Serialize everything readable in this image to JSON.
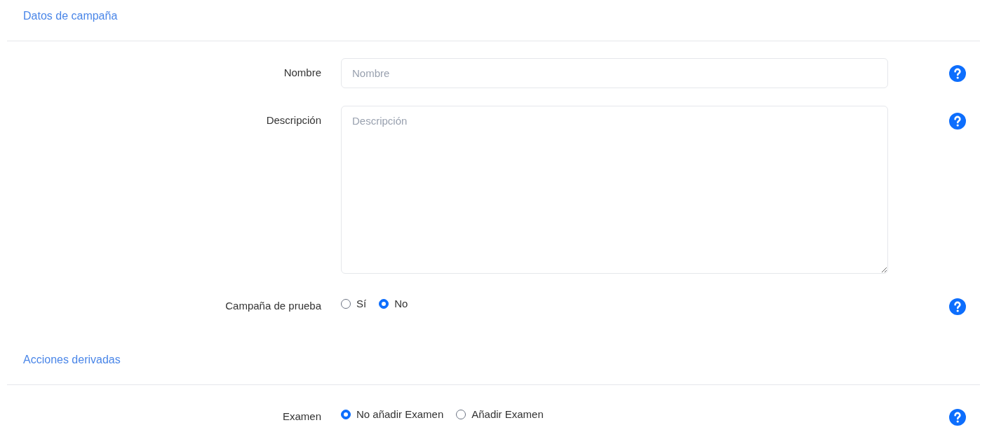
{
  "sections": [
    {
      "title": "Datos de campaña",
      "fields": [
        {
          "kind": "text",
          "label": "Nombre",
          "placeholder": "Nombre"
        },
        {
          "kind": "textarea",
          "label": "Descripción",
          "placeholder": "Descripción"
        },
        {
          "kind": "radio",
          "label": "Campaña de prueba",
          "options": [
            {
              "label": "Sí",
              "selected": false
            },
            {
              "label": "No",
              "selected": true
            }
          ]
        }
      ]
    },
    {
      "title": "Acciones derivadas",
      "fields": [
        {
          "kind": "radio",
          "label": "Examen",
          "options": [
            {
              "label": "No añadir Examen",
              "selected": true
            },
            {
              "label": "Añadir Examen",
              "selected": false
            }
          ]
        }
      ]
    }
  ]
}
